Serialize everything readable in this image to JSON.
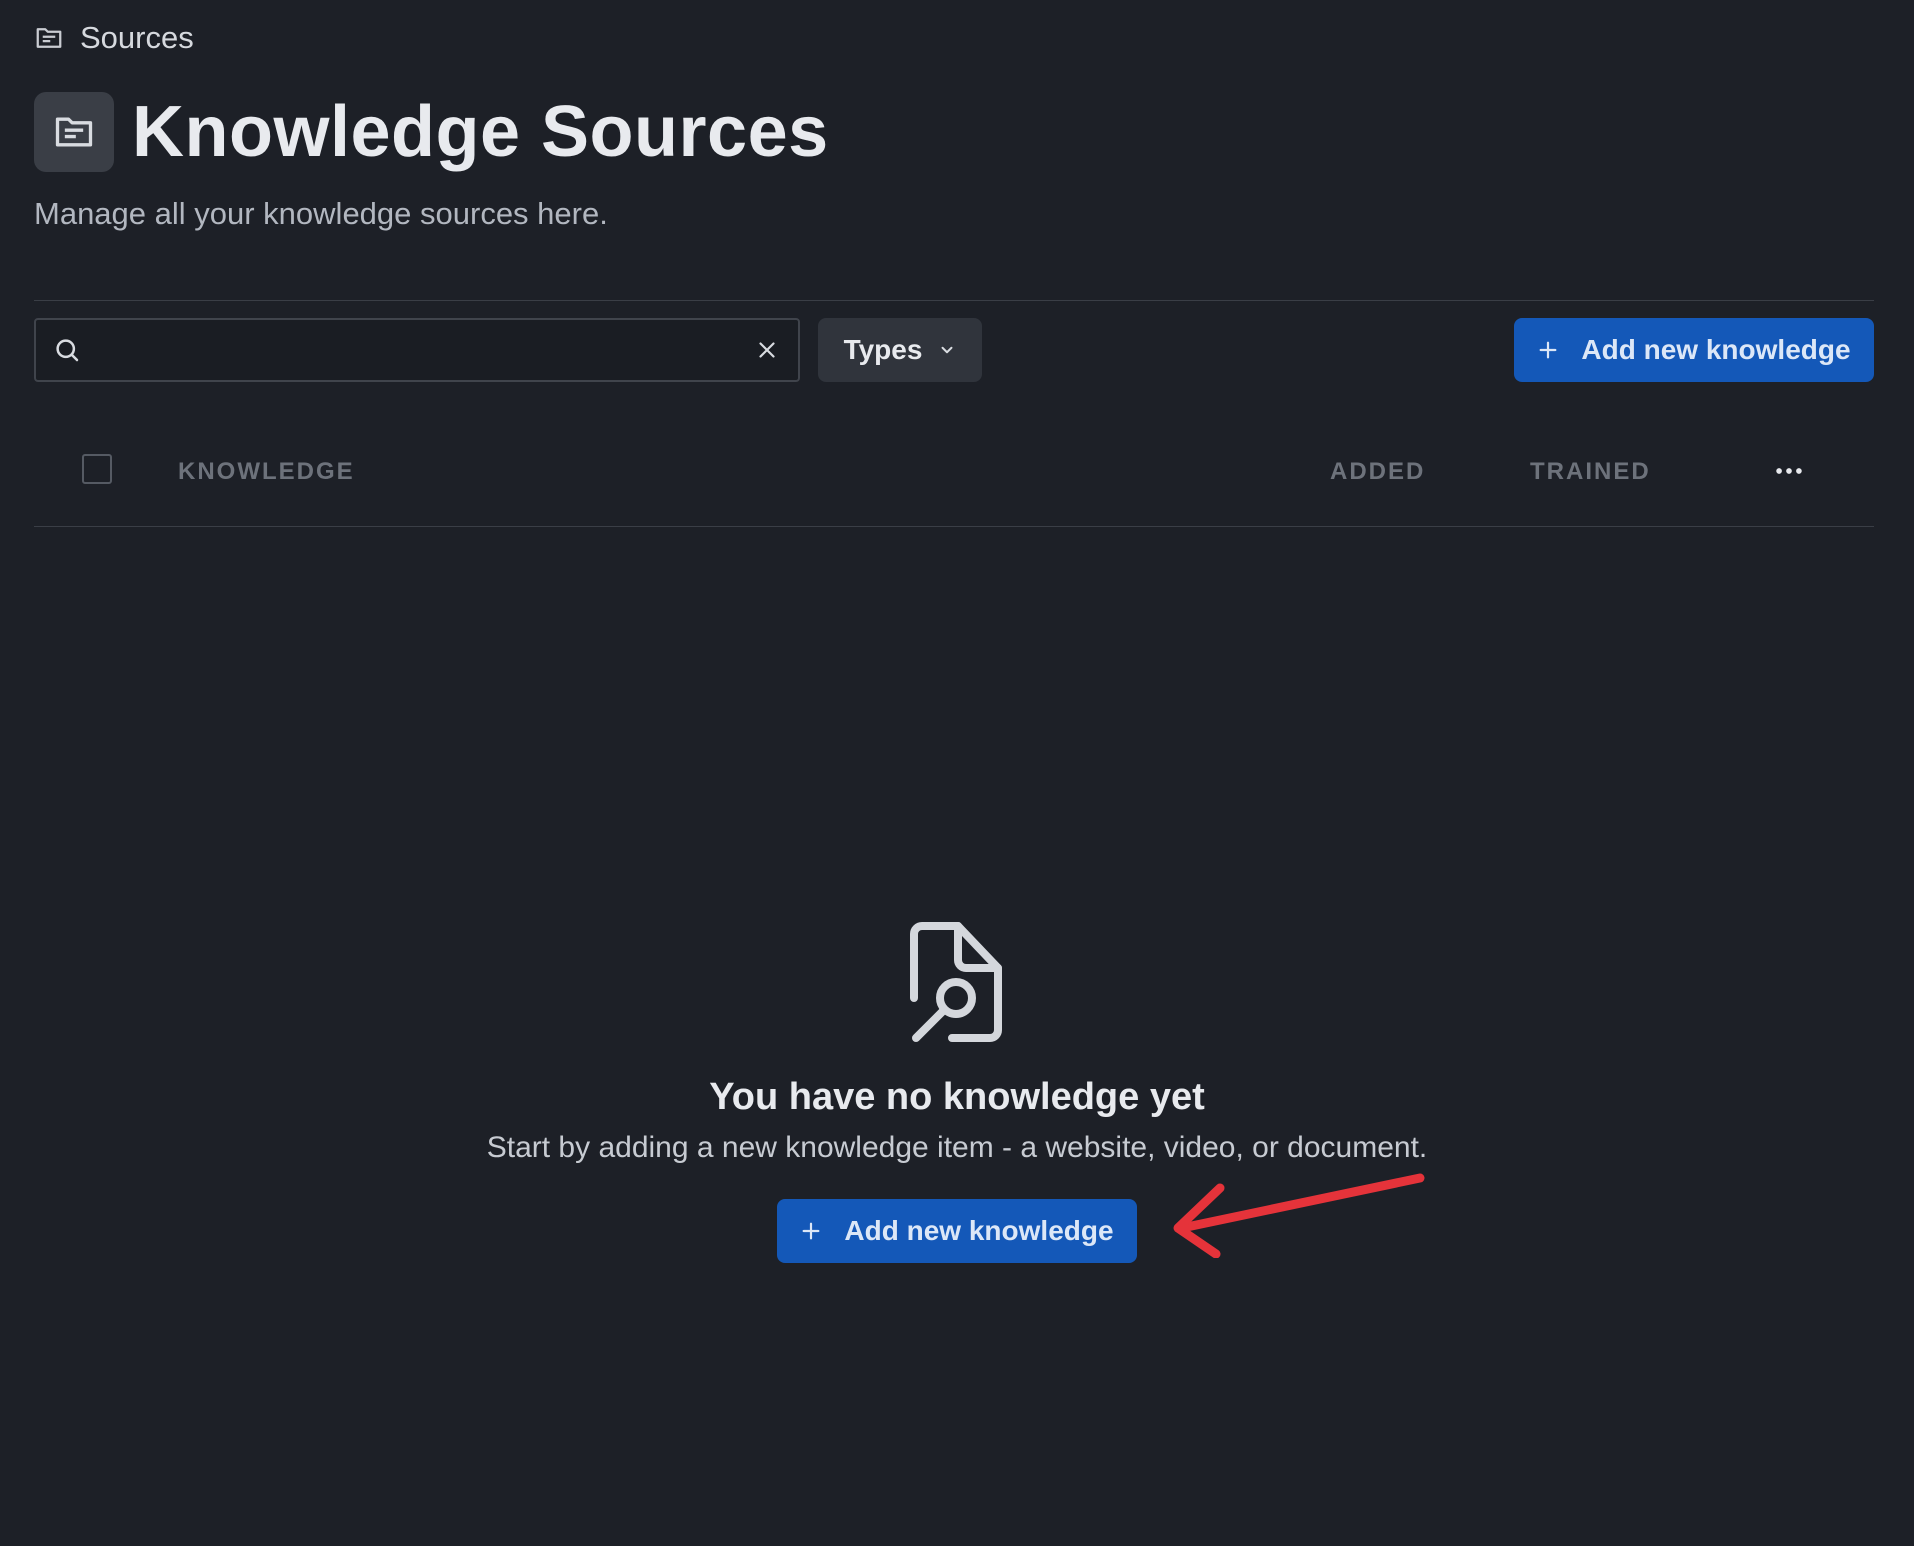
{
  "breadcrumb": {
    "icon": "folder-icon",
    "label": "Sources"
  },
  "header": {
    "icon": "folder-icon",
    "title": "Knowledge Sources",
    "subtitle": "Manage all your knowledge sources here."
  },
  "toolbar": {
    "search": {
      "icon": "search-icon",
      "value": "",
      "clear_icon": "close-icon"
    },
    "types_filter": {
      "label": "Types",
      "icon": "chevron-down-icon"
    },
    "add_button": {
      "label": "Add new knowledge",
      "icon": "plus-icon"
    }
  },
  "table": {
    "columns": [
      "KNOWLEDGE",
      "ADDED",
      "TRAINED"
    ],
    "select_all_checked": false,
    "more_icon": "ellipsis-icon",
    "rows": []
  },
  "empty_state": {
    "icon": "file-search-icon",
    "title": "You have no knowledge yet",
    "description": "Start by adding a new knowledge item - a website, video, or document.",
    "button_label": "Add new knowledge",
    "button_icon": "plus-icon"
  },
  "annotation": {
    "type": "arrow-annotation",
    "color": "#e5333a"
  },
  "colors": {
    "background": "#1d2027",
    "accent": "#1458b8",
    "muted_text": "#6d727b"
  }
}
